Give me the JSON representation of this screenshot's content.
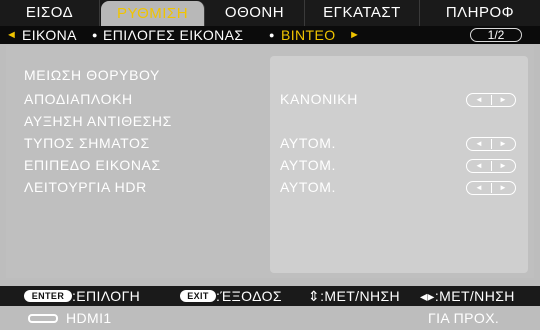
{
  "tabs": [
    "ΕΙΣΟΔ",
    "ΡΥΘΜΙΣΗ",
    "ΟΘΟΝΗ",
    "ΕΓΚΑΤΑΣΤ",
    "ΠΛΗΡΟΦ"
  ],
  "active_tab": "ΡΥΘΜΙΣΗ",
  "submenu": {
    "item1": "ΕΙΚΟΝΑ",
    "item2": "ΕΠΙΛΟΓΕΣ ΕΙΚΟΝΑΣ",
    "item3": "ΒΙΝΤΕΟ",
    "page": "1/2"
  },
  "rows": [
    {
      "label": "ΜΕΙΩΣΗ ΘΟΡΥΒΟΥ",
      "value": ""
    },
    {
      "label": "ΑΠΟΔΙΑΠΛΟΚΗ",
      "value": "ΚΑΝΟΝΙΚΗ"
    },
    {
      "label": "ΑΥΞΗΣΗ ΑΝΤΙΘΕΣΗΣ",
      "value": ""
    },
    {
      "label": "ΤΥΠΟΣ ΣΗΜΑΤΟΣ",
      "value": "ΑΥΤΟΜ."
    },
    {
      "label": "ΕΠΙΠΕΔΟ ΕΙΚΟΝΑΣ",
      "value": "ΑΥΤΟΜ."
    },
    {
      "label": "ΛΕΙΤΟΥΡΓΙΑ HDR",
      "value": "ΑΥΤΟΜ."
    }
  ],
  "help": {
    "enter_key": "ENTER",
    "enter_text": ":ΕΠΙΛΟΓΗ",
    "exit_key": "EXIT",
    "exit_text": ":ΈΞΟΔΟΣ",
    "updown_text": "⇕:ΜΕΤ/ΝΗΣΗ",
    "leftright_text": "◂▸:ΜΕΤ/ΝΗΣΗ"
  },
  "status": {
    "source": "HDMI1",
    "mode": "ΓΙΑ ΠΡΟΧ."
  },
  "colors": {
    "accent": "#f0c400",
    "bar": "#1a1a1a",
    "panel": "#bfbfbf"
  },
  "icons": {
    "left_arrow": "◄",
    "right_arrow": "►",
    "step_left": "◄",
    "step_right": "►"
  }
}
